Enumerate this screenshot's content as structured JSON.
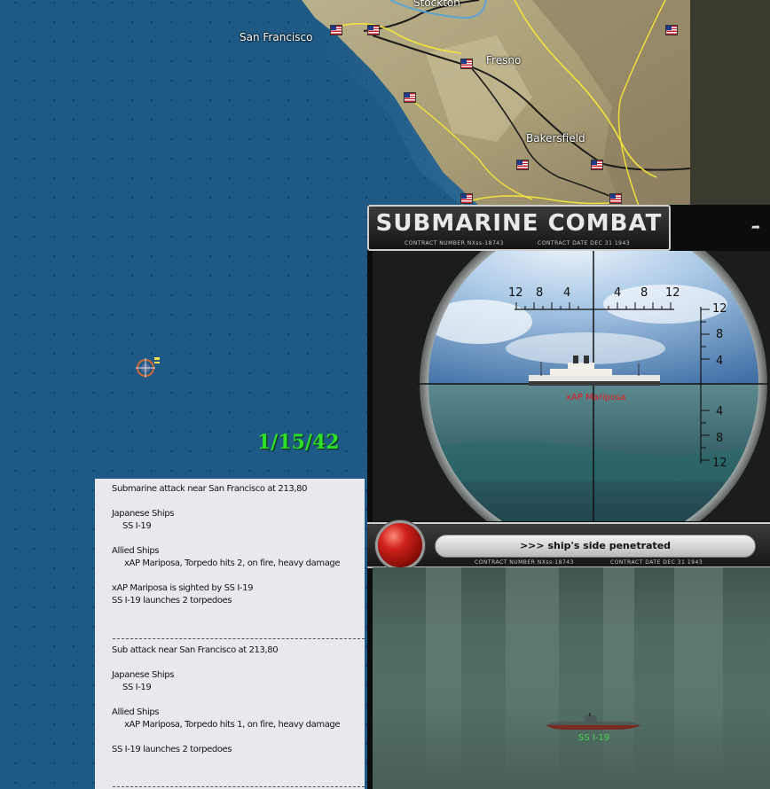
{
  "map": {
    "cities": {
      "stockton": "Stockton",
      "san_francisco": "San Francisco",
      "fresno": "Fresno",
      "bakersfield": "Bakersfield"
    },
    "date": "1/15/42",
    "colors": {
      "ocean": "#1f5a86",
      "date": "#2fe028"
    }
  },
  "combat_log": {
    "lines": [
      "Submarine attack near San Francisco  at 213,80",
      "Japanese Ships",
      "SS I-19",
      "Allied Ships",
      "xAP Mariposa, Torpedo hits 2,  on fire,  heavy damage",
      "xAP Mariposa is sighted by SS I-19",
      "SS I-19 launches 2 torpedoes",
      "Sub attack near San Francisco  at 213,80",
      "Japanese Ships",
      "SS I-19",
      "Allied Ships",
      "xAP Mariposa, Torpedo hits 1,  on fire,  heavy damage",
      "SS I-19 launches 2 torpedoes"
    ]
  },
  "combat_panel": {
    "title": "SUBMARINE COMBAT",
    "contract_number": "CONTRACT NUMBER  NXss-18743",
    "contract_date": "CONTRACT DATE  DEC 31  1943",
    "close_icon": "exit-arrow-icon",
    "scope": {
      "h_ticks": [
        "12",
        "8",
        "4",
        "4",
        "8",
        "12"
      ],
      "v_ticks": [
        "12",
        "8",
        "4",
        "4",
        "8",
        "12"
      ],
      "target_label": "xAP Mariposa",
      "target_color": "#e01b1b"
    },
    "status_message": ">>> ship's side penetrated",
    "submarine_label": "SS I-19",
    "submarine_color": "#3fd84a"
  }
}
